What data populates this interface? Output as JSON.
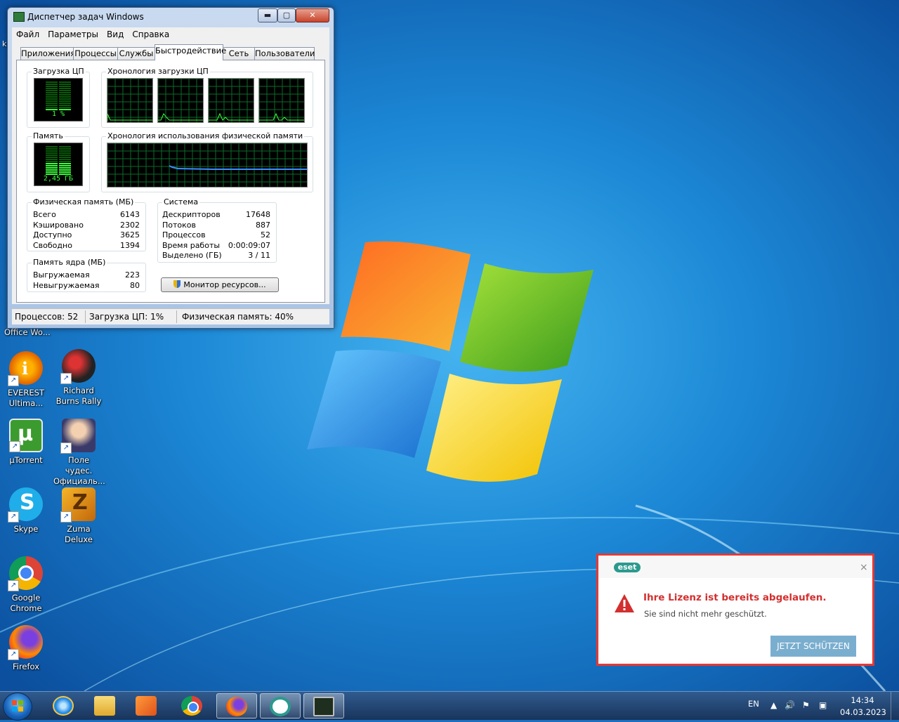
{
  "desktop": {
    "partial_label": "Office Wo...",
    "icons": [
      {
        "label": "EVEREST Ultima...",
        "icon": "everest-icon"
      },
      {
        "label": "Richard Burns Rally",
        "icon": "richard-burns-rally-icon"
      },
      {
        "label": "µTorrent",
        "icon": "utorrent-icon"
      },
      {
        "label": "Поле чудес. Официаль...",
        "icon": "pole-chudes-icon"
      },
      {
        "label": "Skype",
        "icon": "skype-icon"
      },
      {
        "label": "Zuma Deluxe",
        "icon": "zuma-deluxe-icon"
      },
      {
        "label": "Google Chrome",
        "icon": "chrome-icon"
      },
      {
        "label": "Firefox",
        "icon": "firefox-icon"
      }
    ],
    "edge_fragment": "k"
  },
  "taskmgr": {
    "title": "Диспетчер задач Windows",
    "controls": {
      "minimize": "▬",
      "maximize": "▢",
      "close": "✕"
    },
    "menu": [
      "Файл",
      "Параметры",
      "Вид",
      "Справка"
    ],
    "tabs": [
      "Приложения",
      "Процессы",
      "Службы",
      "Быстродействие",
      "Сеть",
      "Пользователи"
    ],
    "active_tab": "Быстродействие",
    "cpu_group_title": "Загрузка ЦП",
    "cpu_value": "1 %",
    "cpu_usage_fraction": 0.01,
    "cpu_history_title": "Хронология загрузки ЦП",
    "cpu_graph_count": 4,
    "mem_group_title": "Память",
    "mem_value": "2,45 ГБ",
    "mem_usage_fraction": 0.4,
    "mem_history_title": "Хронология использования физической памяти",
    "physical_memory": {
      "title": "Физическая память (МБ)",
      "rows": [
        {
          "k": "Всего",
          "v": "6143"
        },
        {
          "k": "Кэшировано",
          "v": "2302"
        },
        {
          "k": "Доступно",
          "v": "3625"
        },
        {
          "k": "Свободно",
          "v": "1394"
        }
      ]
    },
    "kernel_memory": {
      "title": "Память ядра (МБ)",
      "rows": [
        {
          "k": "Выгружаемая",
          "v": "223"
        },
        {
          "k": "Невыгружаемая",
          "v": "80"
        }
      ]
    },
    "system": {
      "title": "Система",
      "rows": [
        {
          "k": "Дескрипторов",
          "v": "17648"
        },
        {
          "k": "Потоков",
          "v": "887"
        },
        {
          "k": "Процессов",
          "v": "52"
        },
        {
          "k": "Время работы",
          "v": "0:00:09:07"
        },
        {
          "k": "Выделено (ГБ)",
          "v": "3 / 11"
        }
      ]
    },
    "resource_monitor_button": "Монитор ресурсов...",
    "status": {
      "processes": "Процессов: 52",
      "cpu": "Загрузка ЦП: 1%",
      "memory": "Физическая память: 40%"
    }
  },
  "eset": {
    "logo": "eset",
    "close": "×",
    "heading": "Ihre Lizenz ist bereits abgelaufen.",
    "subtext": "Sie sind nicht mehr geschützt.",
    "button": "JETZT SCHÜTZEN",
    "accent_color": "#e53935"
  },
  "taskbar": {
    "pinned": [
      "internet-explorer-icon",
      "explorer-folder-icon",
      "media-player-icon",
      "chrome-icon",
      "firefox-icon",
      "eset-icon",
      "task-manager-icon"
    ],
    "active": [
      "firefox-icon",
      "eset-icon",
      "task-manager-icon"
    ],
    "language": "EN",
    "time": "14:34",
    "date": "04.03.2023"
  }
}
